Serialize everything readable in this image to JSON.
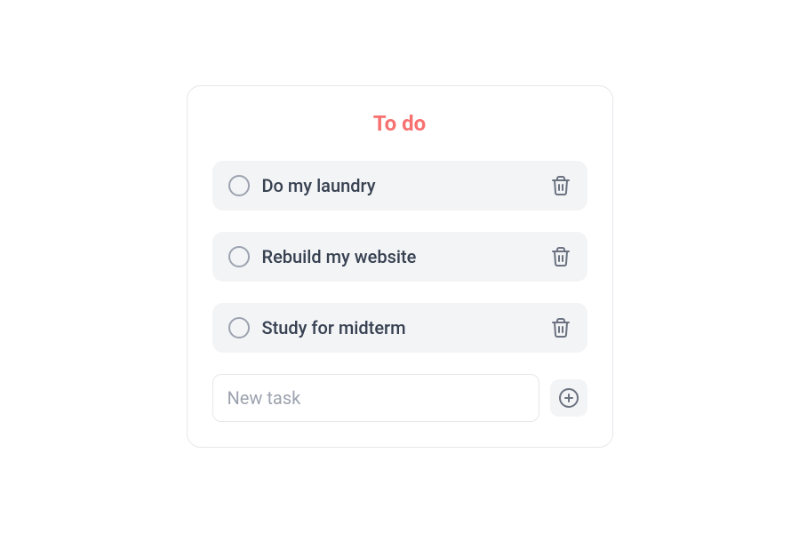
{
  "title": "To do",
  "tasks": [
    {
      "label": "Do my laundry"
    },
    {
      "label": "Rebuild my website"
    },
    {
      "label": "Study for midterm"
    }
  ],
  "newTask": {
    "placeholder": "New task",
    "value": ""
  }
}
